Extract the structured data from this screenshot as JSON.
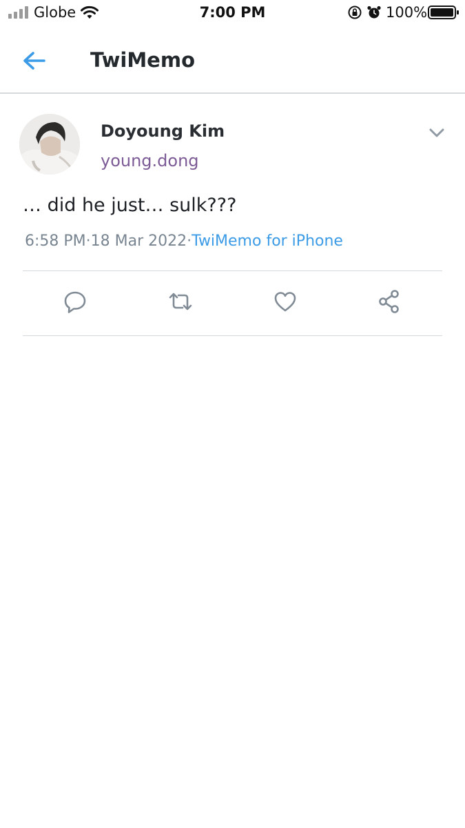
{
  "status_bar": {
    "carrier": "Globe",
    "time": "7:00 PM",
    "battery": "100%"
  },
  "nav": {
    "title": "TwiMemo",
    "accent": "#3b9be6"
  },
  "tweet": {
    "display_name": "Doyoung Kim",
    "username": "young.dong",
    "text": "… did he just… sulk???",
    "time": "6:58 PM",
    "date": "18 Mar 2022",
    "separator": "·",
    "source": "TwiMemo for iPhone"
  },
  "actions": [
    "reply-icon",
    "retweet-icon",
    "like-icon",
    "share-icon"
  ]
}
